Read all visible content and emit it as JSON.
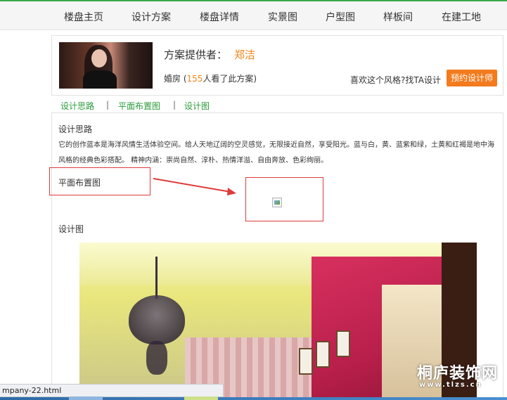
{
  "nav": {
    "items": [
      "楼盘主页",
      "设计方案",
      "楼盘详情",
      "实景图",
      "户型图",
      "样板间",
      "在建工地"
    ]
  },
  "provider": {
    "label": "方案提供者：",
    "name": "郑洁",
    "views_prefix": "婚房 (",
    "views_count": "155",
    "views_suffix": "人看了此方案)",
    "like_text": "喜欢这个风格?找TA设计",
    "book_button": "预约设计师"
  },
  "subtabs": {
    "items": [
      "设计思路",
      "平面布置图",
      "设计图"
    ],
    "separator": "|"
  },
  "sections": {
    "idea_title": "设计思路",
    "idea_text": "它的创作蓝本是海洋风情生活体验空间。给人天地辽阔的空灵感觉，无限接近自然，享受阳光。蓝与白，黄、蓝紫和绿，土黄和红褐是地中海风格的经典色彩搭配。 精神内涵：崇尚自然、淳朴、热情洋溢、自由奔放、色彩绚丽。",
    "floorplan_title": "平面布置图",
    "design_title": "设计图"
  },
  "watermark": {
    "text": "桐庐装饰网",
    "url": "www.tlzs.cn"
  },
  "statusbar": {
    "text": "mpany-22.html"
  },
  "colors": {
    "accent_green": "#2a9b3a",
    "accent_orange": "#f08418",
    "button_orange": "#f37b1d",
    "annotation_red": "#e03a3a"
  }
}
